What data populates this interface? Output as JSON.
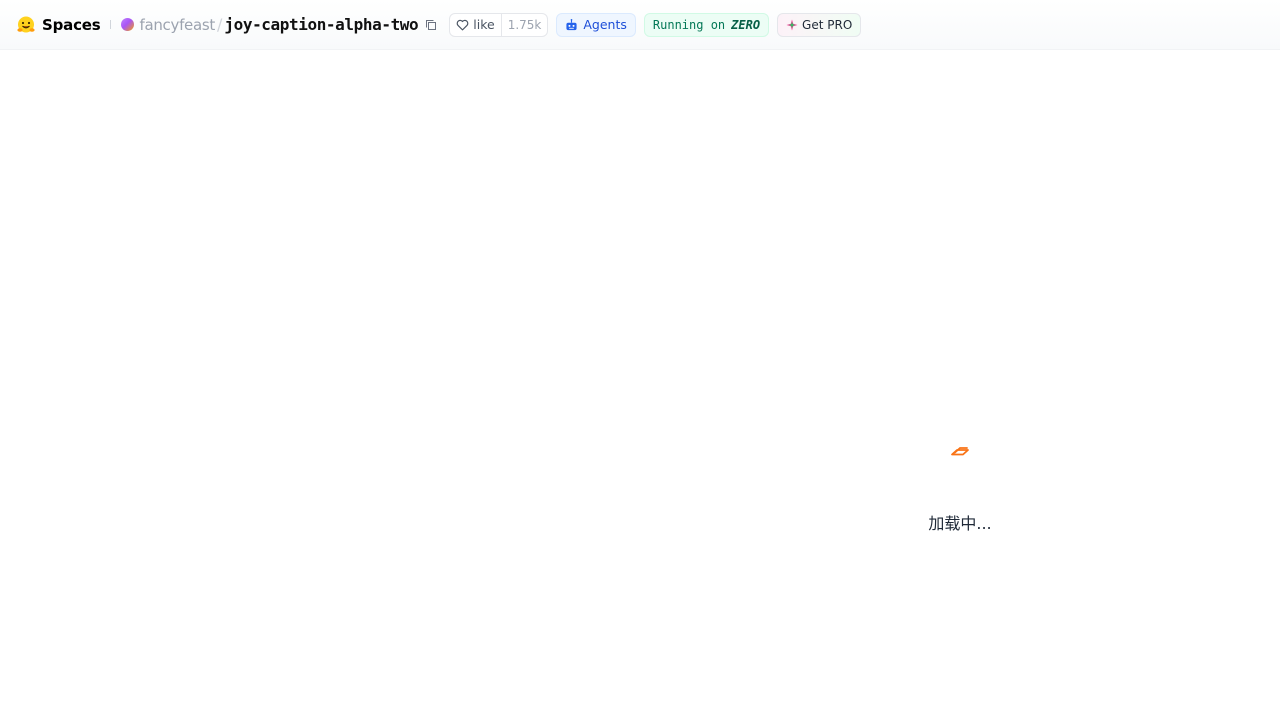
{
  "header": {
    "brand_label": "Spaces",
    "brand_icon": "hugging-face-icon",
    "owner": "fancyfeast",
    "separator": "/",
    "repo": "joy-caption-alpha-two",
    "like_label": "like",
    "like_count": "1.75k",
    "agents_label": "Agents",
    "running_prefix": "Running on",
    "running_hardware": "ZERO",
    "get_pro_label": "Get PRO"
  },
  "main": {
    "loading_text": "加载中..."
  },
  "colors": {
    "accent_orange": "#f97316",
    "agents_blue": "#1d4ed8",
    "running_green": "#047857"
  }
}
